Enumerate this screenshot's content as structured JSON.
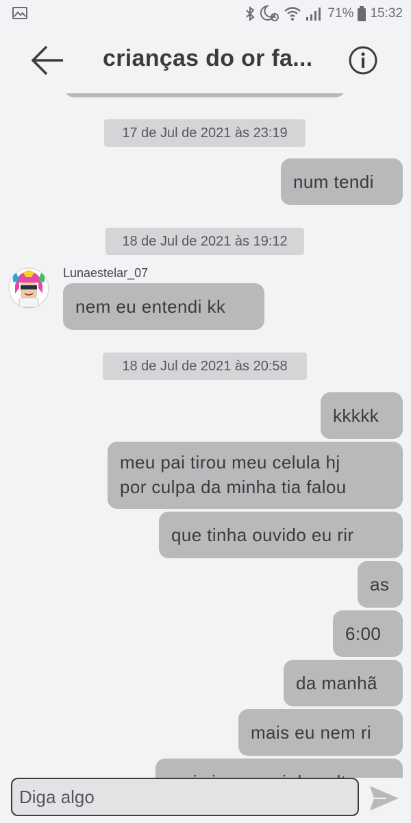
{
  "status_bar": {
    "battery_percent": "71%",
    "time": "15:32"
  },
  "header": {
    "title": "crianças do or fa..."
  },
  "messages": [
    {
      "type": "timestamp",
      "text": "17 de Jul de 2021 às 23:19"
    },
    {
      "type": "outgoing",
      "text": "num tendi"
    },
    {
      "type": "timestamp",
      "text": "18 de Jul de 2021 às 19:12"
    },
    {
      "type": "incoming",
      "sender": "Lunaestelar_07",
      "text": "nem eu entendi kk"
    },
    {
      "type": "timestamp",
      "text": "18 de Jul de 2021 às 20:58"
    },
    {
      "type": "outgoing",
      "text": "kkkkk"
    },
    {
      "type": "outgoing",
      "lines": [
        "meu pai tirou meu celula hj",
        "por culpa da minha tia falou"
      ]
    },
    {
      "type": "outgoing",
      "text": "que tinha ouvido eu rir"
    },
    {
      "type": "outgoing",
      "text": "as"
    },
    {
      "type": "outgoing",
      "text": "6:00"
    },
    {
      "type": "outgoing",
      "text": "da manhã"
    },
    {
      "type": "outgoing",
      "text": "mais eu nem ri"
    },
    {
      "type": "outgoing",
      "text": "mais ja peguei de volta"
    }
  ],
  "composer": {
    "placeholder": "Diga algo"
  },
  "colors": {
    "background": "#f2f3f5",
    "bubble": "#b8b9bb",
    "timestamp_bg": "#d4d5d7",
    "text": "#393b3d"
  },
  "icons": {
    "status_left": "image-icon",
    "bluetooth": "bluetooth-icon",
    "alarm": "moon-alarm-icon",
    "wifi": "wifi-icon",
    "signal": "signal-icon",
    "battery": "battery-icon",
    "back": "back-arrow-icon",
    "info": "info-icon",
    "send": "send-icon"
  }
}
